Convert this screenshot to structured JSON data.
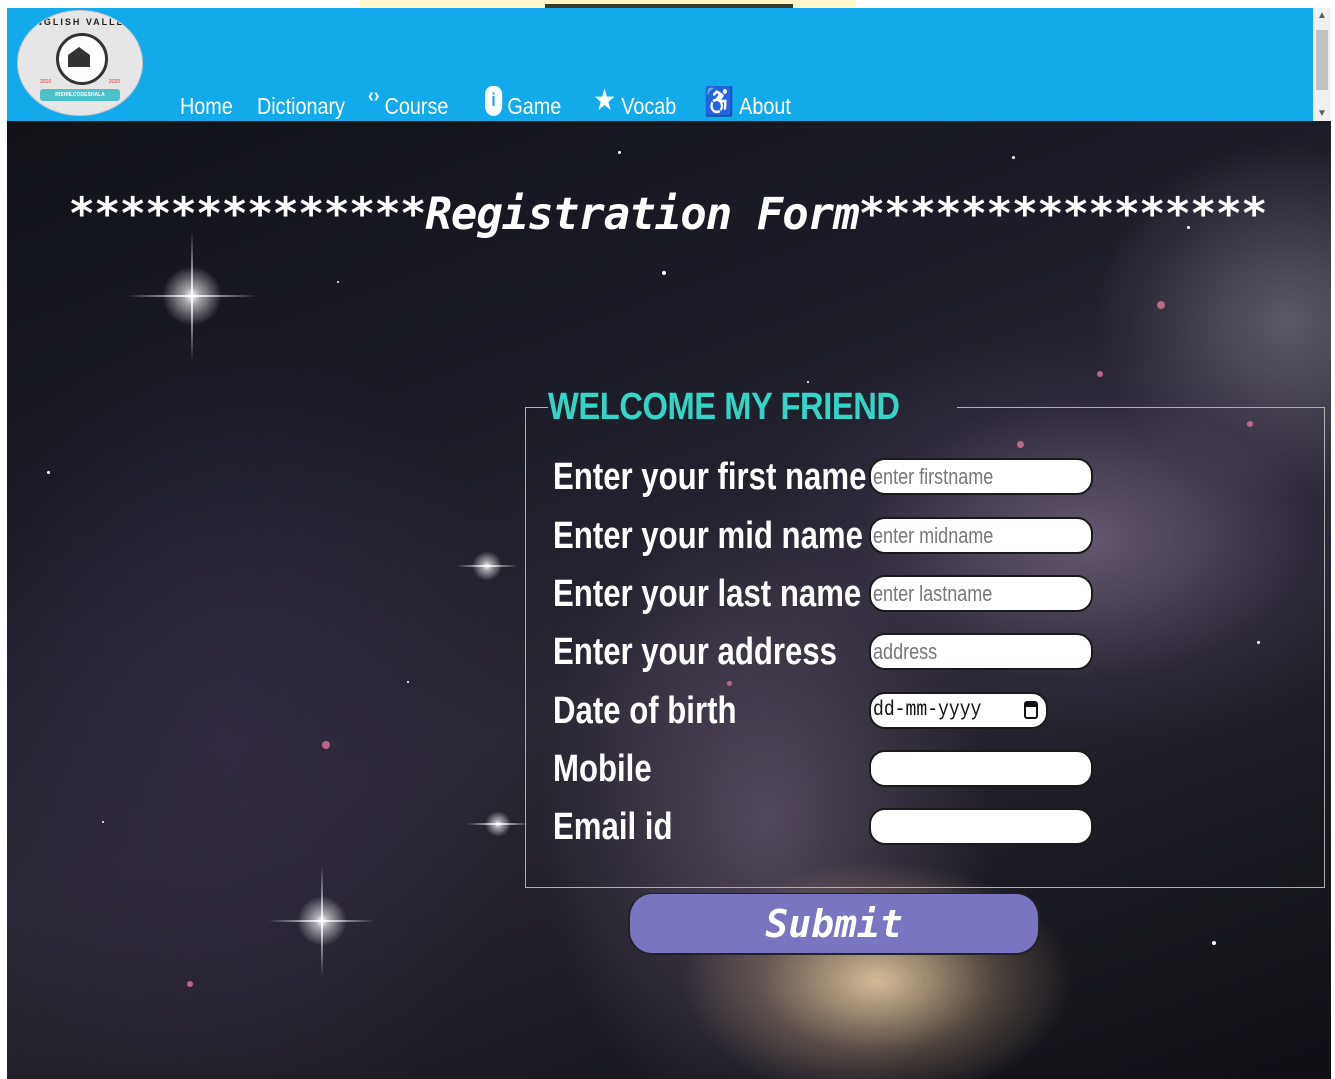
{
  "logo": {
    "arc_text": "ENGLISH VALLEY",
    "banner_text": "RISHIILCODESHALA",
    "year_left": "2010",
    "year_right": "2020"
  },
  "nav": {
    "items": [
      {
        "label": "Home",
        "icon": ""
      },
      {
        "label": "Dictionary",
        "icon": ""
      },
      {
        "label": "Course",
        "icon": "code-icon"
      },
      {
        "label": "Game",
        "icon": "shield-info-icon"
      },
      {
        "label": "Vocab",
        "icon": "star-icon"
      },
      {
        "label": "About",
        "icon": "accessibility-icon"
      }
    ]
  },
  "page": {
    "title": "**************Registration Form****************"
  },
  "form": {
    "legend": "WELCOME MY FRIEND",
    "fields": [
      {
        "label": "Enter your first name",
        "placeholder": "enter firstname",
        "value": ""
      },
      {
        "label": "Enter your mid name",
        "placeholder": "enter midname",
        "value": ""
      },
      {
        "label": "Enter your last name",
        "placeholder": "enter lastname",
        "value": ""
      },
      {
        "label": "Enter your address",
        "placeholder": "address",
        "value": ""
      },
      {
        "label": "Date of birth",
        "placeholder": "dd-mm-yyyy",
        "value": ""
      },
      {
        "label": "Mobile",
        "placeholder": "",
        "value": ""
      },
      {
        "label": "Email id",
        "placeholder": "",
        "value": ""
      }
    ],
    "submit_label": "Submit"
  },
  "colors": {
    "navbar": "#12aaea",
    "legend": "#33d6c6",
    "submit": "#7a75c0",
    "text": "#ffffff"
  }
}
